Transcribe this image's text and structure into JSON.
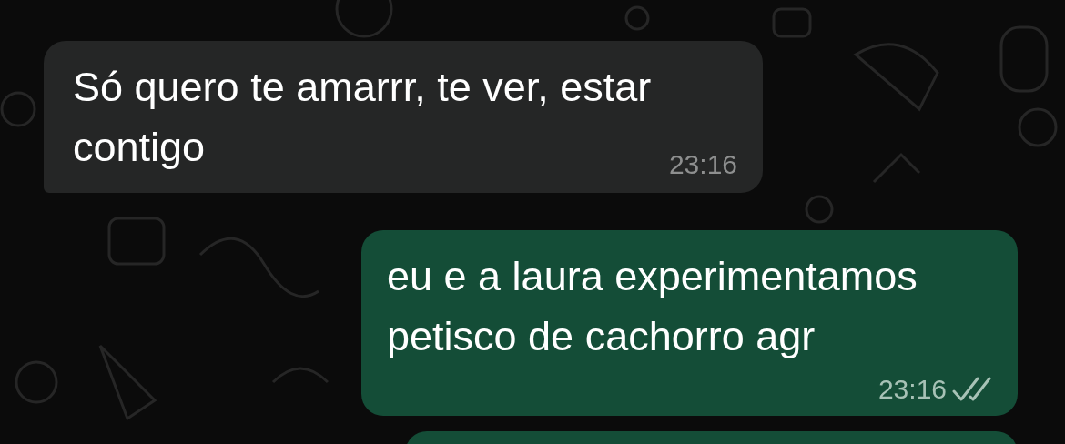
{
  "messages": [
    {
      "kind": "incoming",
      "text": "Só quero te amarrr, te ver, estar contigo",
      "time": "23:16"
    },
    {
      "kind": "outgoing",
      "text": "eu e a laura experimentamos petisco de cachorro agr",
      "time": "23:16",
      "read": false
    },
    {
      "kind": "outgoing"
    }
  ]
}
